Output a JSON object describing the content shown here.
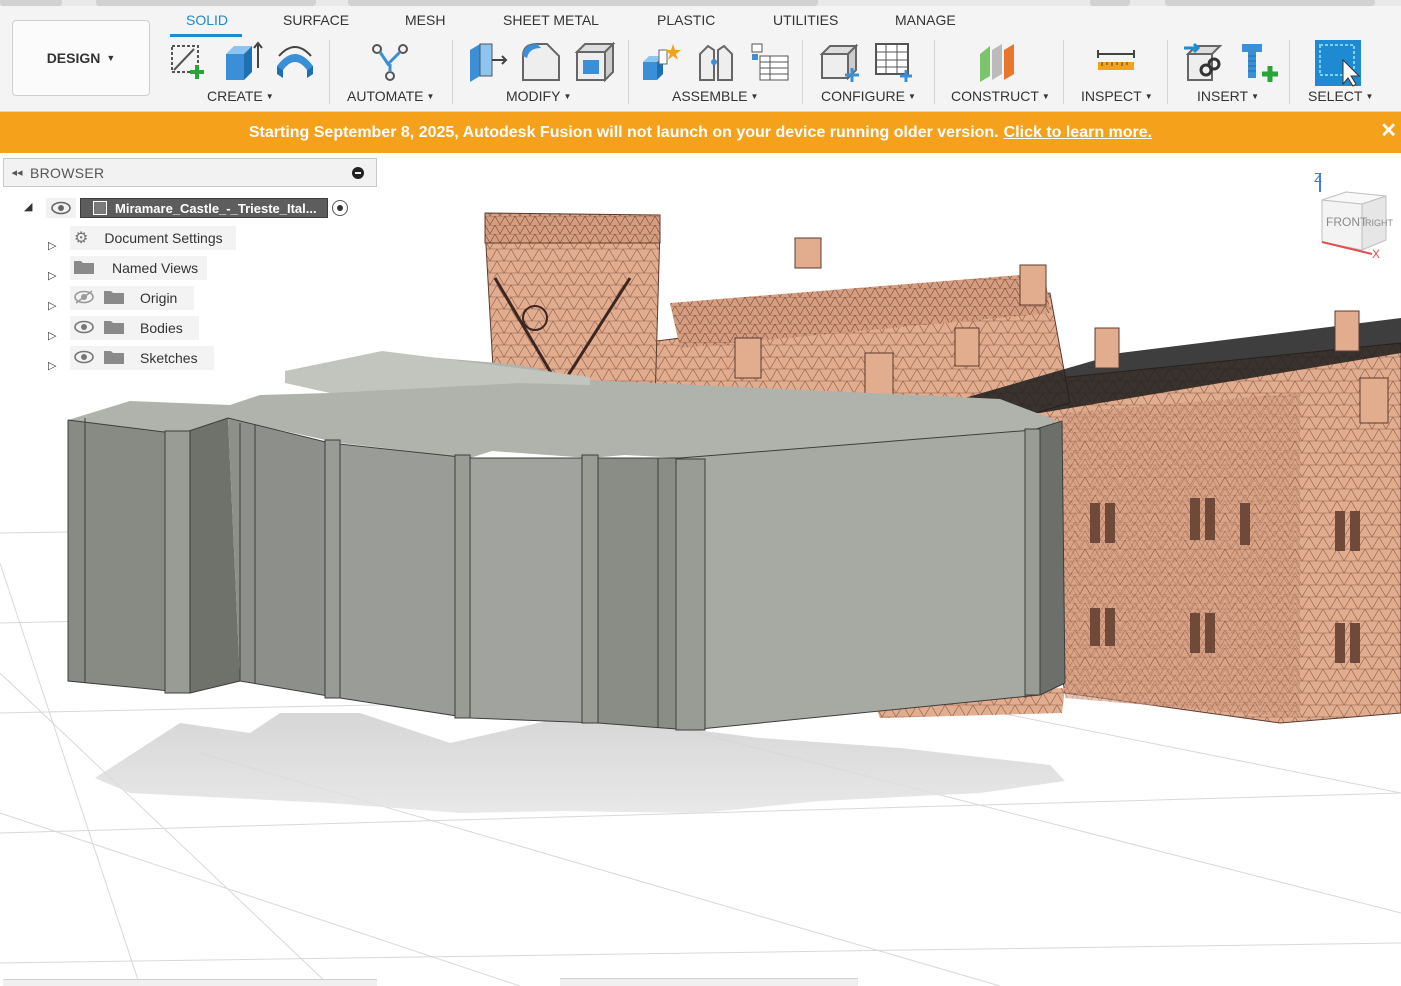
{
  "workspace": {
    "label": "DESIGN"
  },
  "tabs": [
    {
      "label": "SOLID",
      "active": true
    },
    {
      "label": "SURFACE"
    },
    {
      "label": "MESH"
    },
    {
      "label": "SHEET METAL"
    },
    {
      "label": "PLASTIC"
    },
    {
      "label": "UTILITIES"
    },
    {
      "label": "MANAGE"
    }
  ],
  "groups": {
    "create": "CREATE",
    "automate": "AUTOMATE",
    "modify": "MODIFY",
    "assemble": "ASSEMBLE",
    "configure": "CONFIGURE",
    "construct": "CONSTRUCT",
    "inspect": "INSPECT",
    "insert": "INSERT",
    "select": "SELECT"
  },
  "banner": {
    "message": "Starting September 8, 2025, Autodesk Fusion will not launch on your device running older version.",
    "link": "Click to learn more.",
    "close": "✕"
  },
  "browser": {
    "title": "BROWSER",
    "root": "Miramare_Castle_-_Trieste_Ital...",
    "items": [
      {
        "label": "Document Settings"
      },
      {
        "label": "Named Views"
      },
      {
        "label": "Origin"
      },
      {
        "label": "Bodies"
      },
      {
        "label": "Sketches"
      }
    ]
  },
  "viewcube": {
    "axis_z": "Z",
    "axis_x": "X",
    "front": "FRONT",
    "right": "RIGHT"
  },
  "colors": {
    "accent": "#1d8ad1",
    "banner": "#f5a11c",
    "solid_body": "#a9aca4",
    "mesh_body": "#e0a98c"
  }
}
